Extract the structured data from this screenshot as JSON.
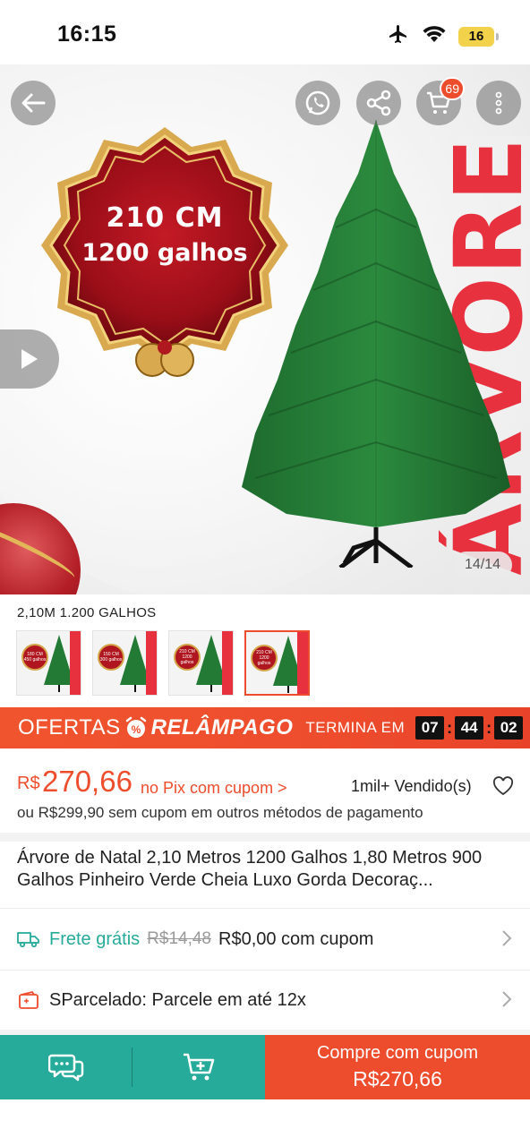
{
  "status_bar": {
    "time": "16:15",
    "battery": "16",
    "icons": [
      "airplane-icon",
      "wifi-icon",
      "battery-icon"
    ]
  },
  "hero": {
    "badge_line1": "210 CM",
    "badge_line2": "1200 galhos",
    "side_word": "ÁRVORE",
    "page_counter": "14/14",
    "cart_count": "69"
  },
  "variation": {
    "label": "2,10M 1.200 GALHOS",
    "thumbnails": [
      {
        "line1": "180 CM",
        "line2": "450 galhos",
        "selected": false
      },
      {
        "line1": "150 CM",
        "line2": "300 galhos",
        "selected": false
      },
      {
        "line1": "210 CM",
        "line2": "1200 galhos",
        "selected": false
      },
      {
        "line1": "210 CM",
        "line2": "1200 galhos",
        "selected": true
      }
    ]
  },
  "flash_sale": {
    "ofertas": "OFERTAS",
    "relampago": "RELÂMPAGO",
    "ends_in": "TERMINA EM",
    "hours": "07",
    "minutes": "44",
    "seconds": "02"
  },
  "price": {
    "currency": "R$",
    "value": "270,66",
    "pix_label": "no Pix com cupom >",
    "sold": "1mil+ Vendido(s)",
    "alt_price": "ou R$299,90 sem cupom em outros métodos de pagamento"
  },
  "product": {
    "title": "Árvore de Natal 2,10 Metros 1200 Galhos 1,80 Metros 900 Galhos Pinheiro Verde Cheia Luxo Gorda Decoraç..."
  },
  "shipping": {
    "free_label": "Frete grátis",
    "old_price": "R$14,48",
    "new_price": "R$0,00 com cupom"
  },
  "installments": {
    "label": "SParcelado: Parcele em até 12x"
  },
  "bottom_bar": {
    "buy_label": "Compre com cupom",
    "buy_price": "R$270,66"
  },
  "colors": {
    "accent": "#ee4d2d",
    "teal": "#26aa99",
    "dark_red": "#b0161f",
    "gold": "#d4a64a"
  }
}
